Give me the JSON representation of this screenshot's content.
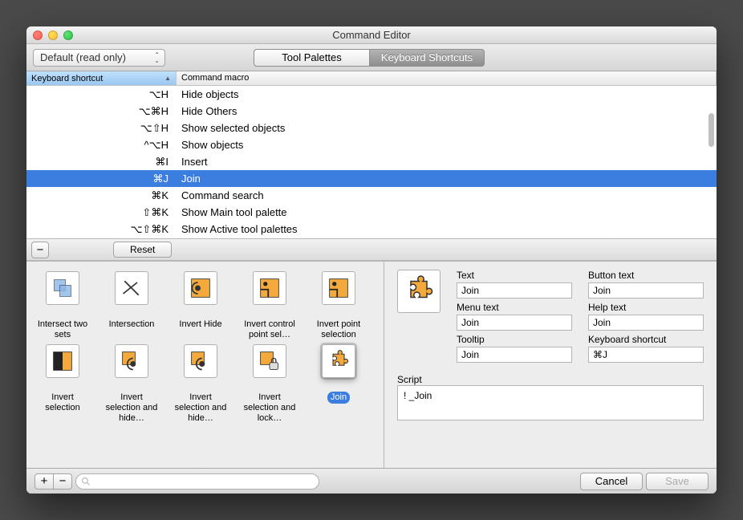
{
  "window": {
    "title": "Command Editor"
  },
  "toolbar": {
    "mode_label": "Default (read only)",
    "tabs": {
      "palettes": "Tool Palettes",
      "shortcuts": "Keyboard Shortcuts"
    }
  },
  "columns": {
    "shortcut": "Keyboard shortcut",
    "macro": "Command macro"
  },
  "rows": [
    {
      "shortcut": "⌥H",
      "macro": "Hide objects",
      "selected": false
    },
    {
      "shortcut": "⌥⌘H",
      "macro": "Hide Others",
      "selected": false
    },
    {
      "shortcut": "⌥⇧H",
      "macro": "Show selected objects",
      "selected": false
    },
    {
      "shortcut": "^⌥H",
      "macro": "Show objects",
      "selected": false
    },
    {
      "shortcut": "⌘I",
      "macro": "Insert",
      "selected": false
    },
    {
      "shortcut": "⌘J",
      "macro": "Join",
      "selected": true
    },
    {
      "shortcut": "⌘K",
      "macro": "Command search",
      "selected": false
    },
    {
      "shortcut": "⇧⌘K",
      "macro": "Show Main tool palette",
      "selected": false
    },
    {
      "shortcut": "⌥⇧⌘K",
      "macro": "Show Active tool palettes",
      "selected": false
    }
  ],
  "midbar": {
    "reset": "Reset"
  },
  "icons": [
    {
      "name": "intersect-two-sets",
      "label": "Intersect two sets",
      "sel": false
    },
    {
      "name": "intersection",
      "label": "Intersection",
      "sel": false
    },
    {
      "name": "invert-hide",
      "label": "Invert Hide",
      "sel": false
    },
    {
      "name": "invert-control-point-sel",
      "label": "Invert control point sel…",
      "sel": false
    },
    {
      "name": "invert-point-selection",
      "label": "Invert point selection",
      "sel": false
    },
    {
      "name": "invert-selection",
      "label": "Invert selection",
      "sel": false
    },
    {
      "name": "invert-selection-hide",
      "label": "Invert selection and hide…",
      "sel": false
    },
    {
      "name": "invert-selection-hide2",
      "label": "Invert selection and hide…",
      "sel": false
    },
    {
      "name": "invert-selection-lock",
      "label": "Invert selection and lock…",
      "sel": false
    },
    {
      "name": "join",
      "label": "Join",
      "sel": true
    }
  ],
  "details": {
    "labels": {
      "text": "Text",
      "button_text": "Button text",
      "menu_text": "Menu text",
      "help_text": "Help text",
      "tooltip": "Tooltip",
      "keyboard_shortcut": "Keyboard shortcut",
      "script": "Script"
    },
    "values": {
      "text": "Join",
      "button_text": "Join",
      "menu_text": "Join",
      "help_text": "Join",
      "tooltip": "Join",
      "keyboard_shortcut": "⌘J",
      "script": "! _Join"
    }
  },
  "footer": {
    "cancel": "Cancel",
    "save": "Save"
  }
}
